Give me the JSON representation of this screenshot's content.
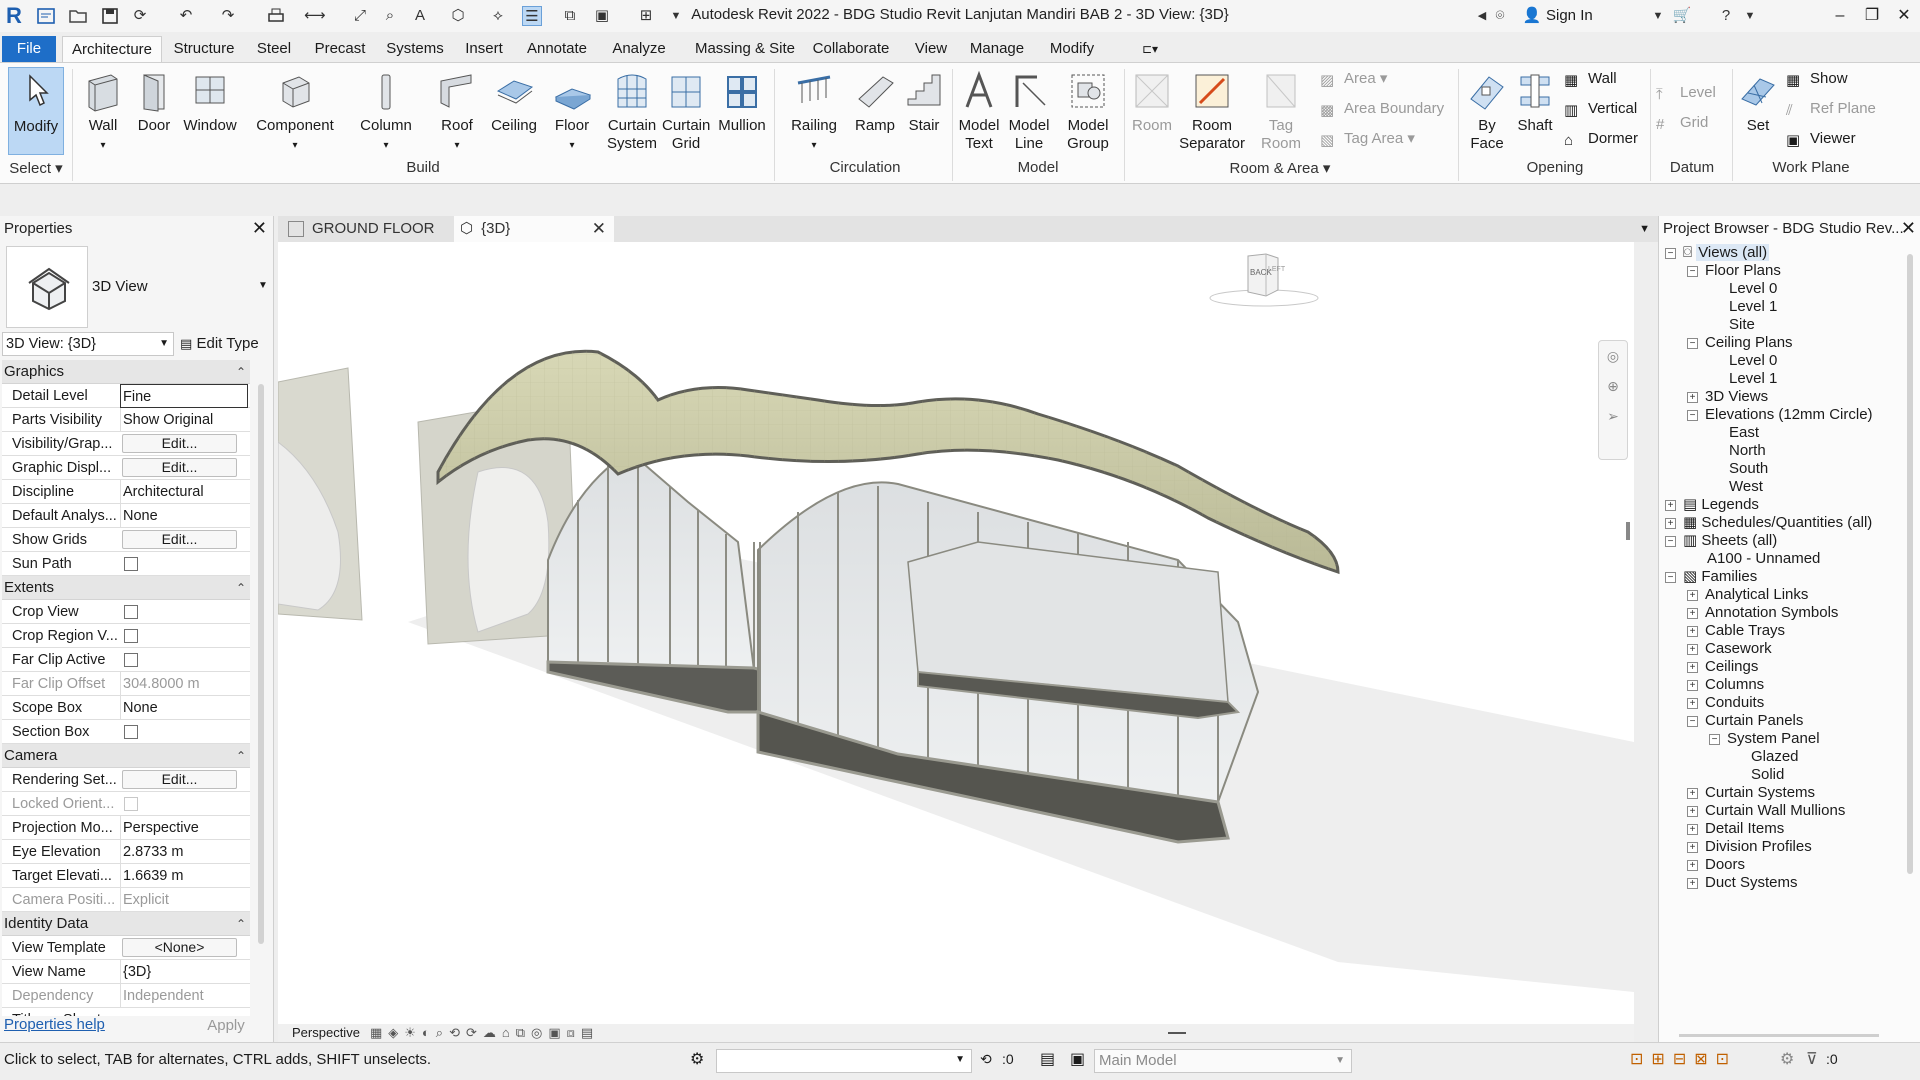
{
  "app": {
    "title": "Autodesk Revit 2022 - BDG Studio Revit Lanjutan Mandiri BAB 2 - 3D View: {3D}",
    "signin": "Sign In",
    "logo": "R"
  },
  "tabs": [
    "File",
    "Architecture",
    "Structure",
    "Steel",
    "Precast",
    "Systems",
    "Insert",
    "Annotate",
    "Analyze",
    "Massing & Site",
    "Collaborate",
    "View",
    "Manage",
    "Modify"
  ],
  "ribbon": {
    "select": {
      "modify": "Modify",
      "select": "Select"
    },
    "build": {
      "title": "Build",
      "wall": "Wall",
      "door": "Door",
      "window": "Window",
      "component": "Component",
      "column": "Column",
      "roof": "Roof",
      "ceiling": "Ceiling",
      "floor": "Floor",
      "curtain_system": "Curtain System",
      "curtain_grid": "Curtain Grid",
      "mullion": "Mullion"
    },
    "circulation": {
      "title": "Circulation",
      "railing": "Railing",
      "ramp": "Ramp",
      "stair": "Stair"
    },
    "model": {
      "title": "Model",
      "model_text": "Model Text",
      "model_line": "Model Line",
      "model_group": "Model Group"
    },
    "room_area": {
      "title": "Room & Area",
      "room": "Room",
      "room_separator": "Room Separator",
      "tag_room": "Tag Room",
      "area": "Area",
      "area_boundary": "Area Boundary",
      "tag_area": "Tag Area"
    },
    "opening": {
      "title": "Opening",
      "by_face": "By Face",
      "shaft": "Shaft",
      "wall": "Wall",
      "vertical": "Vertical",
      "dormer": "Dormer"
    },
    "datum": {
      "title": "Datum",
      "level": "Level",
      "grid": "Grid"
    },
    "work_plane": {
      "title": "Work Plane",
      "set": "Set",
      "show": "Show",
      "ref_plane": "Ref Plane",
      "viewer": "Viewer"
    }
  },
  "properties": {
    "title": "Properties",
    "type_name": "3D View",
    "instance_selector": "3D View: {3D}",
    "edit_type": "Edit Type",
    "help_link": "Properties help",
    "apply": "Apply",
    "groups": {
      "graphics": "Graphics",
      "extents": "Extents",
      "camera": "Camera",
      "identity": "Identity Data"
    },
    "rows": {
      "detail_level": {
        "k": "Detail Level",
        "v": "Fine"
      },
      "parts_visibility": {
        "k": "Parts Visibility",
        "v": "Show Original"
      },
      "visibility_graphics": {
        "k": "Visibility/Grap...",
        "v": "Edit..."
      },
      "graphic_display": {
        "k": "Graphic Displ...",
        "v": "Edit..."
      },
      "discipline": {
        "k": "Discipline",
        "v": "Architectural"
      },
      "default_analysis": {
        "k": "Default Analys...",
        "v": "None"
      },
      "show_grids": {
        "k": "Show Grids",
        "v": "Edit..."
      },
      "sun_path": {
        "k": "Sun Path"
      },
      "crop_view": {
        "k": "Crop View"
      },
      "crop_region": {
        "k": "Crop Region V..."
      },
      "far_clip_active": {
        "k": "Far Clip Active"
      },
      "far_clip_offset": {
        "k": "Far Clip Offset",
        "v": "304.8000 m"
      },
      "scope_box": {
        "k": "Scope Box",
        "v": "None"
      },
      "section_box": {
        "k": "Section Box"
      },
      "rendering_settings": {
        "k": "Rendering Set...",
        "v": "Edit..."
      },
      "locked_orientation": {
        "k": "Locked Orient..."
      },
      "projection_mode": {
        "k": "Projection Mo...",
        "v": "Perspective"
      },
      "eye_elevation": {
        "k": "Eye Elevation",
        "v": "2.8733 m"
      },
      "target_elevation": {
        "k": "Target Elevati...",
        "v": "1.6639 m"
      },
      "camera_position": {
        "k": "Camera Positi...",
        "v": "Explicit"
      },
      "view_template": {
        "k": "View Template",
        "v": "<None>"
      },
      "view_name": {
        "k": "View Name",
        "v": "{3D}"
      },
      "dependency": {
        "k": "Dependency",
        "v": "Independent"
      },
      "title_on_sheet": {
        "k": "Title on Sheet"
      }
    }
  },
  "view_tabs": {
    "ground_floor": "GROUND FLOOR",
    "three_d": "{3D}"
  },
  "viewcube": {
    "back": "BACK",
    "left": "LEFT"
  },
  "view_bar": {
    "projection": "Perspective"
  },
  "project_browser": {
    "title": "Project Browser - BDG Studio Rev...",
    "views_all": "Views (all)",
    "floor_plans": "Floor Plans",
    "fp_items": [
      "Level 0",
      "Level 1",
      "Site"
    ],
    "ceiling_plans": "Ceiling Plans",
    "cp_items": [
      "Level 0",
      "Level 1"
    ],
    "views_3d": "3D Views",
    "elevations": "Elevations (12mm Circle)",
    "elev_items": [
      "East",
      "North",
      "South",
      "West"
    ],
    "legends": "Legends",
    "schedules": "Schedules/Quantities (all)",
    "sheets": "Sheets (all)",
    "sheet_item": "A100 - Unnamed",
    "families": "Families",
    "fam_items": [
      "Analytical Links",
      "Annotation Symbols",
      "Cable Trays",
      "Casework",
      "Ceilings",
      "Columns",
      "Conduits",
      "Curtain Panels"
    ],
    "system_panel": "System Panel",
    "sp_items": [
      "Glazed",
      "Solid"
    ],
    "fam_items2": [
      "Curtain Systems",
      "Curtain Wall Mullions",
      "Detail Items",
      "Division Profiles",
      "Doors",
      "Duct Systems"
    ]
  },
  "status": {
    "message": "Click to select, TAB for alternates, CTRL adds, SHIFT unselects.",
    "zero_a": ":0",
    "model": "Main Model",
    "zero_b": ":0"
  },
  "colors": {
    "file_tab": "#1e6ec8",
    "modify_active": "#bcd8f4",
    "roof": "#c9c9a4",
    "glass": "#d9dfe2"
  }
}
